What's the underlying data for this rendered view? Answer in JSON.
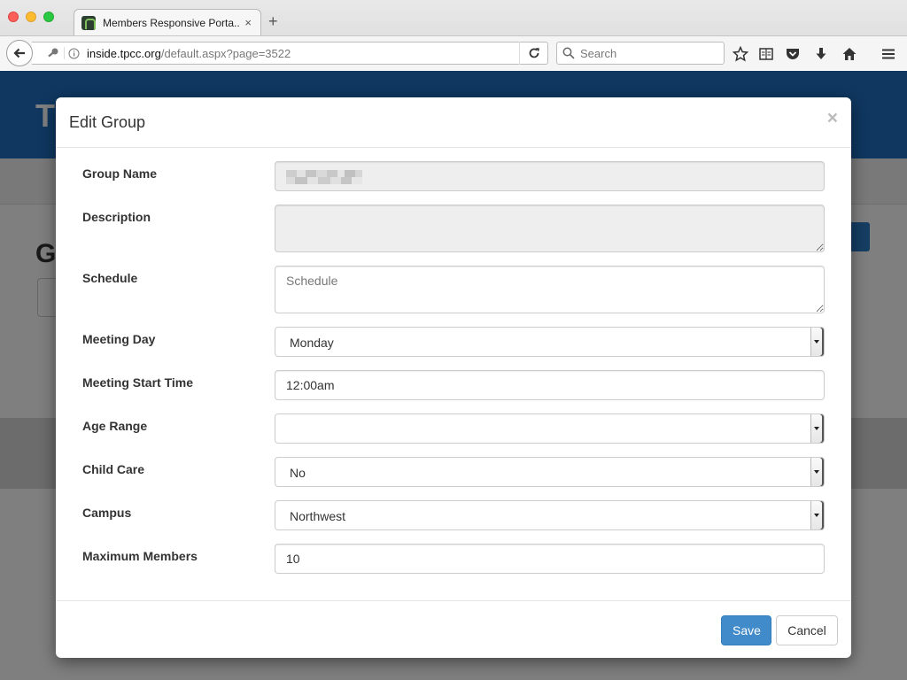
{
  "browser": {
    "tab_title": "Members Responsive Porta...",
    "tab_close": "×",
    "new_tab": "+",
    "url_host": "inside.tpcc.org",
    "url_path": "/default.aspx?page=3522",
    "search_placeholder": "Search"
  },
  "background_page": {
    "header_initial": "T",
    "heading_initial": "G",
    "header_color": "#1f6fc1"
  },
  "modal": {
    "title": "Edit Group",
    "close": "×",
    "fields": {
      "group_name": {
        "label": "Group Name",
        "value": ""
      },
      "description": {
        "label": "Description",
        "value": ""
      },
      "schedule": {
        "label": "Schedule",
        "value": "",
        "placeholder": "Schedule"
      },
      "meeting_day": {
        "label": "Meeting Day",
        "value": "Monday"
      },
      "meeting_start_time": {
        "label": "Meeting Start Time",
        "value": "12:00am"
      },
      "age_range": {
        "label": "Age Range",
        "value": ""
      },
      "child_care": {
        "label": "Child Care",
        "value": "No"
      },
      "campus": {
        "label": "Campus",
        "value": "Northwest"
      },
      "maximum_members": {
        "label": "Maximum Members",
        "value": "10"
      }
    },
    "save_label": "Save",
    "cancel_label": "Cancel",
    "primary_color": "#428bca"
  },
  "icons": [
    "back-arrow-icon",
    "key-icon",
    "info-icon",
    "reload-icon",
    "search-icon",
    "star-icon",
    "reading-list-icon",
    "pocket-icon",
    "download-icon",
    "home-icon",
    "menu-icon"
  ]
}
